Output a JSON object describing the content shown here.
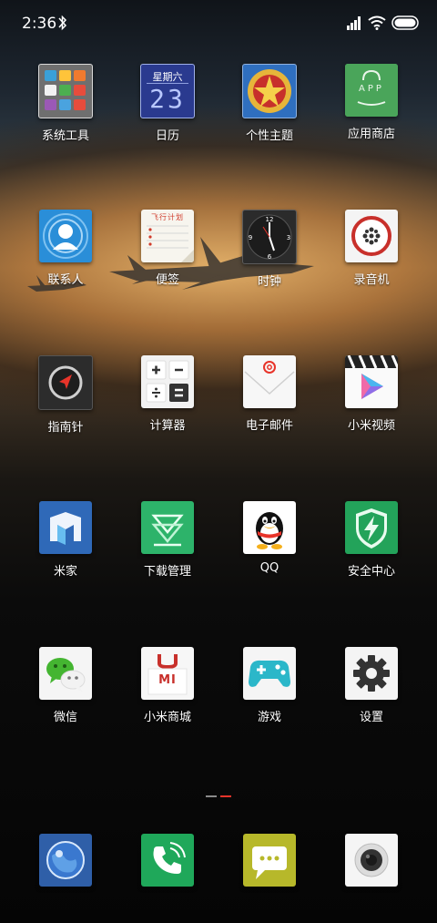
{
  "status": {
    "time": "2:36",
    "bluetooth_icon": "bluetooth-icon",
    "signal_icon": "signal-icon",
    "wifi_icon": "wifi-icon",
    "battery_icon": "battery-icon"
  },
  "apps": [
    {
      "label": "系统工具",
      "icon": "folder-icon"
    },
    {
      "label": "日历",
      "icon": "calendar-icon",
      "weekday": "星期六",
      "day": "23"
    },
    {
      "label": "个性主题",
      "icon": "theme-icon"
    },
    {
      "label": "应用商店",
      "icon": "app-store-icon",
      "badge": "APP"
    },
    {
      "label": "联系人",
      "icon": "contacts-icon"
    },
    {
      "label": "便签",
      "icon": "notes-icon",
      "heading": "飞行计划"
    },
    {
      "label": "时钟",
      "icon": "clock-icon"
    },
    {
      "label": "录音机",
      "icon": "recorder-icon"
    },
    {
      "label": "指南针",
      "icon": "compass-icon"
    },
    {
      "label": "计算器",
      "icon": "calculator-icon"
    },
    {
      "label": "电子邮件",
      "icon": "email-icon"
    },
    {
      "label": "小米视频",
      "icon": "video-icon"
    },
    {
      "label": "米家",
      "icon": "mijia-icon"
    },
    {
      "label": "下载管理",
      "icon": "download-icon"
    },
    {
      "label": "QQ",
      "icon": "qq-icon"
    },
    {
      "label": "安全中心",
      "icon": "security-icon"
    },
    {
      "label": "微信",
      "icon": "wechat-icon"
    },
    {
      "label": "小米商城",
      "icon": "mi-store-icon",
      "badge": "MI"
    },
    {
      "label": "游戏",
      "icon": "game-icon"
    },
    {
      "label": "设置",
      "icon": "settings-icon"
    }
  ],
  "dock": [
    {
      "icon": "browser-icon"
    },
    {
      "icon": "phone-icon"
    },
    {
      "icon": "messages-icon"
    },
    {
      "icon": "camera-icon"
    }
  ],
  "pager": {
    "pages": 2,
    "current": 2
  },
  "colors": {
    "accent": "#e8342a"
  }
}
